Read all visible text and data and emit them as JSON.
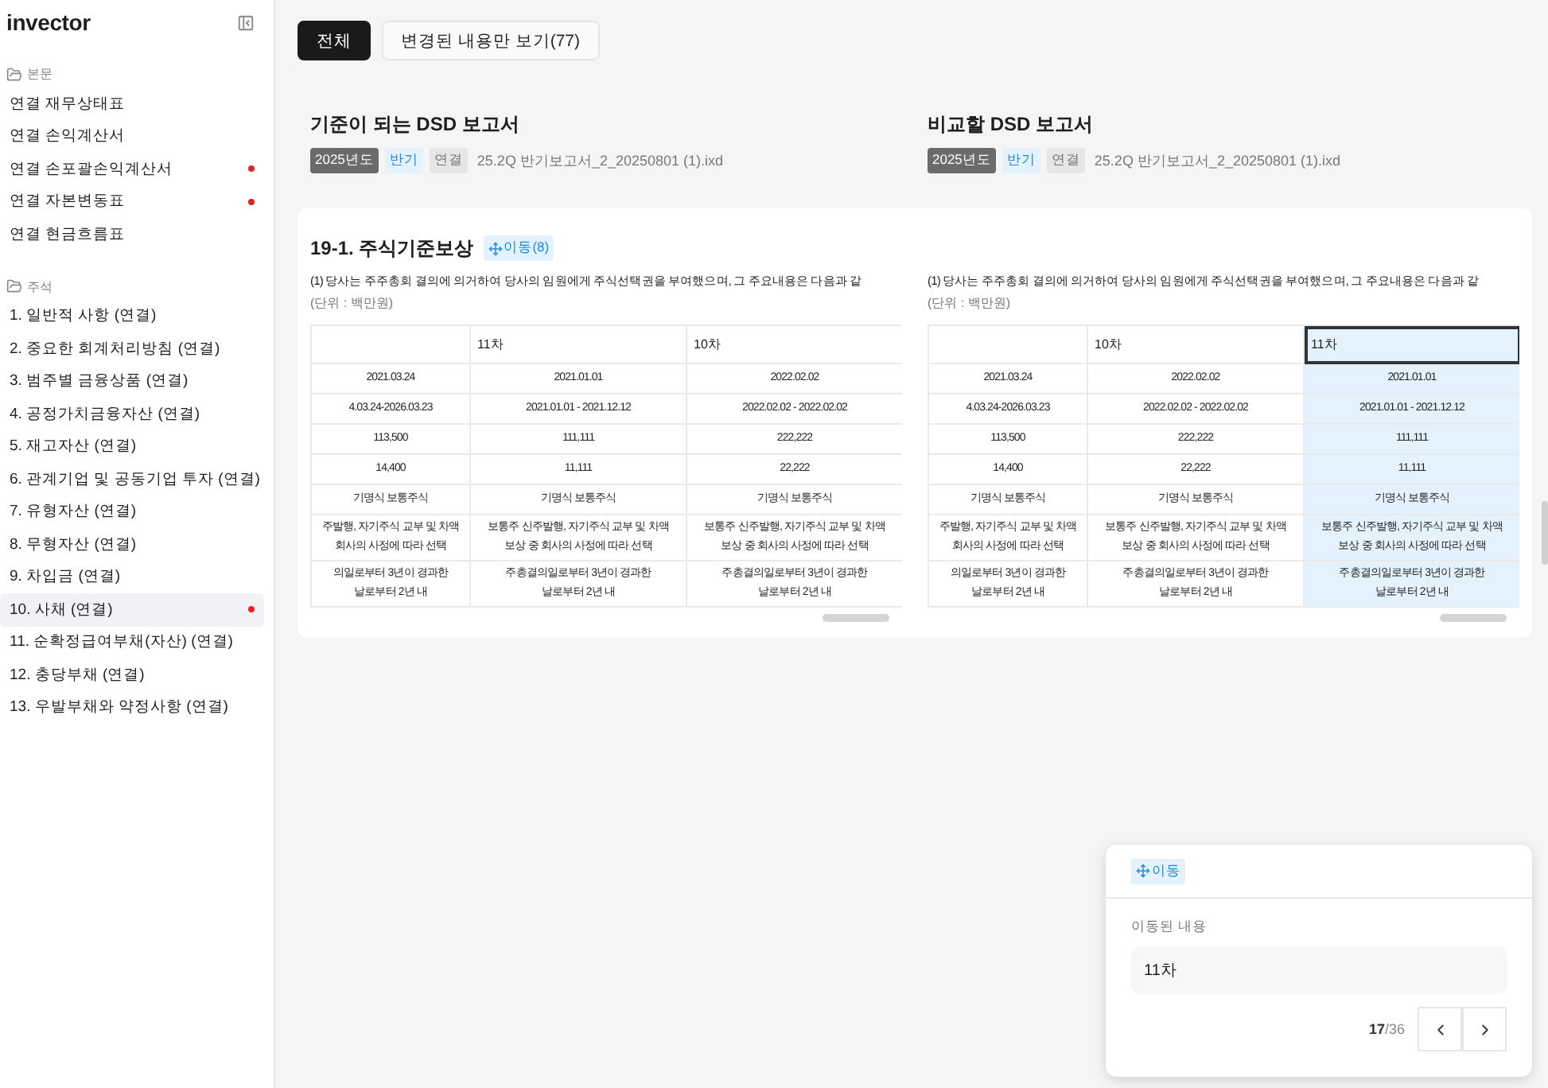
{
  "sidebar": {
    "logo": "invector",
    "sections": [
      {
        "title": "본문",
        "items": [
          {
            "label": "연결 재무상태표",
            "changed": false,
            "selected": false
          },
          {
            "label": "연결 손익계산서",
            "changed": false,
            "selected": false
          },
          {
            "label": "연결 손포괄손익계산서",
            "changed": true,
            "selected": false
          },
          {
            "label": "연결 자본변동표",
            "changed": true,
            "selected": false
          },
          {
            "label": "연결 현금흐름표",
            "changed": false,
            "selected": false
          }
        ]
      },
      {
        "title": "주석",
        "items": [
          {
            "label": "1. 일반적 사항 (연결)",
            "changed": false,
            "selected": false
          },
          {
            "label": "2. 중요한 회계처리방침 (연결)",
            "changed": false,
            "selected": false
          },
          {
            "label": "3. 범주별 금융상품 (연결)",
            "changed": false,
            "selected": false
          },
          {
            "label": "4. 공정가치금융자산 (연결)",
            "changed": false,
            "selected": false
          },
          {
            "label": "5. 재고자산 (연결)",
            "changed": false,
            "selected": false
          },
          {
            "label": "6. 관계기업 및 공동기업 투자 (연결)",
            "changed": false,
            "selected": false
          },
          {
            "label": "7. 유형자산 (연결)",
            "changed": false,
            "selected": false
          },
          {
            "label": "8. 무형자산 (연결)",
            "changed": false,
            "selected": false
          },
          {
            "label": "9. 차입금 (연결)",
            "changed": false,
            "selected": false
          },
          {
            "label": "10. 사채 (연결)",
            "changed": true,
            "selected": true
          },
          {
            "label": "11. 순확정급여부채(자산) (연결)",
            "changed": false,
            "selected": false
          },
          {
            "label": "12. 충당부채 (연결)",
            "changed": false,
            "selected": false
          },
          {
            "label": "13. 우발부채와 약정사항 (연결)",
            "changed": false,
            "selected": false
          }
        ]
      }
    ]
  },
  "filter_tabs": [
    {
      "label": "전체",
      "selected": true
    },
    {
      "label": "변경된 내용만 보기(77)",
      "selected": false
    }
  ],
  "reports": [
    {
      "heading": "기준이 되는 DSD 보고서",
      "tags": [
        {
          "label": "2025년도",
          "kind": "year"
        },
        {
          "label": "반기",
          "kind": "period"
        },
        {
          "label": "연결",
          "kind": "scope"
        }
      ],
      "file": "25.2Q 반기보고서_2_20250801 (1).ixd"
    },
    {
      "heading": "비교할 DSD 보고서",
      "tags": [
        {
          "label": "2025년도",
          "kind": "year"
        },
        {
          "label": "반기",
          "kind": "period"
        },
        {
          "label": "연결",
          "kind": "scope"
        }
      ],
      "file": "25.2Q 반기보고서_2_20250801 (1).ixd"
    }
  ],
  "section": {
    "title": "19-1. 주식기준보상",
    "move_badge": "이동(8)",
    "panes": [
      {
        "paragraph": "(1) 당사는 주주총회 결의에 의거하여 당사의 임원에게 주식선택권을 부여했으며, 그 주요내용은 다음과 같",
        "unit": "(단위 : 백만원)",
        "table": {
          "columns": [
            {
              "highlighted": false
            },
            {
              "header": "11차",
              "highlighted": false
            },
            {
              "header": "10차",
              "highlighted": false
            }
          ],
          "rows": [
            [
              "2021.03.24",
              "2021.01.01",
              "2022.02.02"
            ],
            [
              "4.03.24-2026.03.23",
              "2021.01.01 - 2021.12.12",
              "2022.02.02 - 2022.02.02"
            ],
            [
              "113,500",
              "111,111",
              "222,222"
            ],
            [
              "14,400",
              "11,111",
              "22,222"
            ],
            [
              "기명식 보통주식",
              "기명식 보통주식",
              "기명식 보통주식"
            ],
            [
              "주발행, 자기주식 교부 및 차액\n회사의 사정에 따라 선택",
              "보통주 신주발행, 자기주식 교부 및 차액\n보상 중 회사의 사정에 따라 선택",
              "보통주 신주발행, 자기주식 교부 및 차액\n보상 중 회사의 사정에 따라 선택"
            ],
            [
              "의일로부터 3년이 경과한\n날로부터 2년 내",
              "주총결의일로부터 3년이 경과한\n날로부터 2년 내",
              "주총결의일로부터 3년이 경과한\n날로부터 2년 내"
            ]
          ]
        }
      },
      {
        "paragraph": "(1) 당사는 주주총회 결의에 의거하여 당사의 임원에게 주식선택권을 부여했으며, 그 주요내용은 다음과 같",
        "unit": "(단위 : 백만원)",
        "table": {
          "columns": [
            {
              "highlighted": false
            },
            {
              "header": "10차",
              "highlighted": false
            },
            {
              "header": "11차",
              "highlighted": true
            }
          ],
          "rows": [
            [
              "2021.03.24",
              "2022.02.02",
              "2021.01.01"
            ],
            [
              "4.03.24-2026.03.23",
              "2022.02.02 - 2022.02.02",
              "2021.01.01 - 2021.12.12"
            ],
            [
              "113,500",
              "222,222",
              "111,111"
            ],
            [
              "14,400",
              "22,222",
              "11,111"
            ],
            [
              "기명식 보통주식",
              "기명식 보통주식",
              "기명식 보통주식"
            ],
            [
              "주발행, 자기주식 교부 및 차액\n회사의 사정에 따라 선택",
              "보통주 신주발행, 자기주식 교부 및 차액\n보상 중 회사의 사정에 따라 선택",
              "보통주 신주발행, 자기주식 교부 및 차액\n보상 중 회사의 사정에 따라 선택"
            ],
            [
              "의일로부터 3년이 경과한\n날로부터 2년 내",
              "주총결의일로부터 3년이 경과한\n날로부터 2년 내",
              "주총결의일로부터 3년이 경과한\n날로부터 2년 내"
            ]
          ]
        }
      }
    ]
  },
  "move_panel": {
    "badge": "이동",
    "label": "이동된 내용",
    "value": "11차",
    "page_current": "17",
    "page_total": "/36"
  }
}
